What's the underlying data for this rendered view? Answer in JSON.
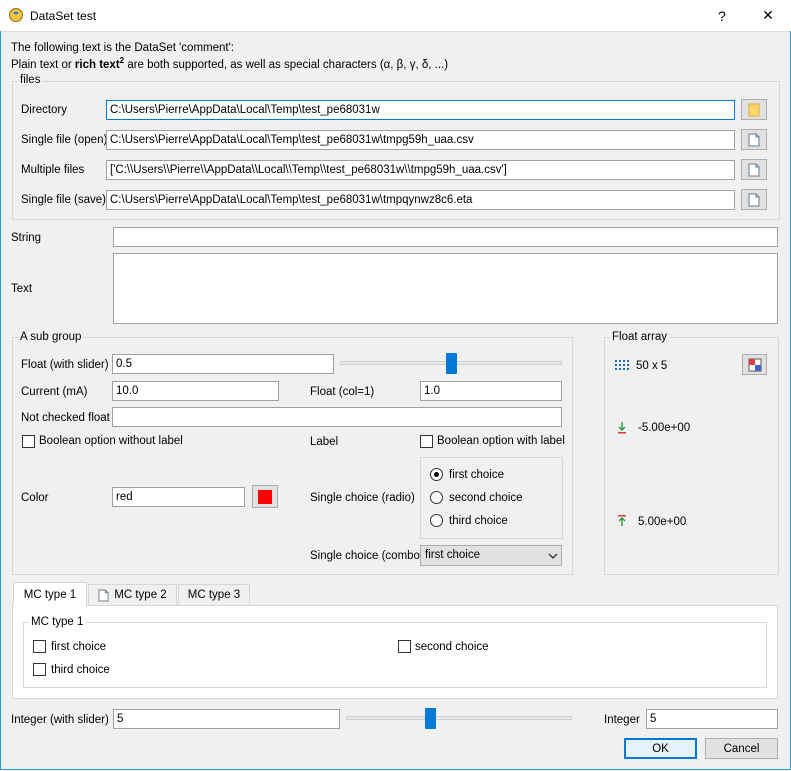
{
  "window": {
    "title": "DataSet test",
    "help": "?",
    "close": "✕"
  },
  "intro": {
    "line1": "The following text is the DataSet 'comment':",
    "line2_prefix": "Plain text or ",
    "line2_bold": "rich text",
    "line2_sup": "2",
    "line2_suffix": " are both supported, as well as special characters (α, β, γ, δ, ...)"
  },
  "files": {
    "title": "files",
    "directory_label": "Directory",
    "directory_value": "C:\\Users\\Pierre\\AppData\\Local\\Temp\\test_pe68031w",
    "open_label": "Single file (open)",
    "open_value": "C:\\Users\\Pierre\\AppData\\Local\\Temp\\test_pe68031w\\tmpg59h_uaa.csv",
    "multi_label": "Multiple files",
    "multi_value": "['C:\\\\Users\\\\Pierre\\\\AppData\\\\Local\\\\Temp\\\\test_pe68031w\\\\tmpg59h_uaa.csv']",
    "save_label": "Single file (save)",
    "save_value": "C:\\Users\\Pierre\\AppData\\Local\\Temp\\test_pe68031w\\tmpqynwz8c6.eta"
  },
  "string_label": "String",
  "string_value": "",
  "text_label": "Text",
  "subgroup": {
    "title": "A sub group",
    "float_slider_label": "Float (with slider)",
    "float_slider_value": "0.5",
    "float_slider_fraction": 0.5,
    "current_label": "Current (mA)",
    "current_value": "10.0",
    "float_col_label": "Float (col=1)",
    "float_col_value": "1.0",
    "not_checked_label": "Not checked float",
    "not_checked_value": "",
    "bool_no_label": "Boolean option without label",
    "label_text": "Label",
    "bool_with_label": "Boolean option with label",
    "color_label": "Color",
    "color_value": "red",
    "color_swatch": "#ff0000",
    "radio_label": "Single choice (radio)",
    "radio_options": [
      "first choice",
      "second choice",
      "third choice"
    ],
    "radio_selected": "first choice",
    "combo_label": "Single choice (combo)",
    "combo_value": "first choice"
  },
  "float_array": {
    "title": "Float array",
    "shape": "50 x 5",
    "min": "-5.00e+00",
    "max": "5.00e+00"
  },
  "tabs": [
    "MC type 1",
    "MC type 2",
    "MC type 3"
  ],
  "active_tab": "MC type 1",
  "mc": {
    "title": "MC type 1",
    "options": [
      "first choice",
      "second choice",
      "third choice"
    ]
  },
  "integer": {
    "slider_label": "Integer (with slider)",
    "slider_value": "5",
    "slider_fraction": 0.5,
    "label": "Integer",
    "value": "5"
  },
  "buttons": {
    "ok": "OK",
    "cancel": "Cancel"
  },
  "colors": {
    "accent": "#0078d7",
    "folder": "#ffd766",
    "swatch": "#ff0000"
  }
}
